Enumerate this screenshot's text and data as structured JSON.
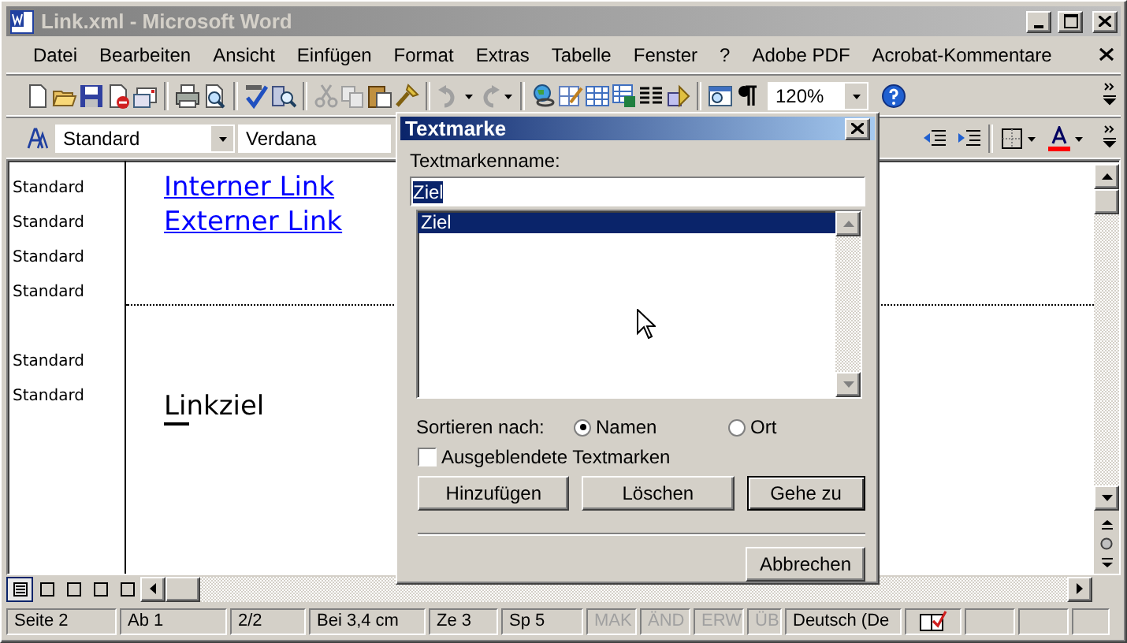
{
  "window": {
    "title": "Link.xml - Microsoft Word"
  },
  "menu": [
    "Datei",
    "Bearbeiten",
    "Ansicht",
    "Einfügen",
    "Format",
    "Extras",
    "Tabelle",
    "Fenster",
    "?",
    "Adobe PDF",
    "Acrobat-Kommentare"
  ],
  "standard_toolbar": {
    "zoom": "120%"
  },
  "formatting_toolbar": {
    "style": "Standard",
    "font": "Verdana"
  },
  "document": {
    "paragraphs": [
      {
        "kind": "link",
        "style": "Standard",
        "text": "Interner Link"
      },
      {
        "kind": "link",
        "style": "Standard",
        "text": "Externer Link"
      },
      {
        "kind": "empty",
        "style": "Standard"
      },
      {
        "kind": "empty",
        "style": "Standard"
      },
      {
        "kind": "break"
      },
      {
        "kind": "empty",
        "style": "Standard"
      },
      {
        "kind": "text",
        "style": "Standard",
        "text": "Linkziel"
      }
    ]
  },
  "view_buttons": [
    {
      "selected": true
    },
    {
      "selected": false
    },
    {
      "selected": false
    },
    {
      "selected": false
    },
    {
      "selected": false
    }
  ],
  "status_bar": [
    {
      "text": "Seite 2",
      "disabled": false
    },
    {
      "text": "Ab 1",
      "disabled": false
    },
    {
      "text": "2/2",
      "disabled": false
    },
    {
      "text": "Bei 3,4 cm",
      "disabled": false
    },
    {
      "text": "Ze 3",
      "disabled": false
    },
    {
      "text": "Sp 5",
      "disabled": false
    },
    {
      "text": "MAK",
      "disabled": true
    },
    {
      "text": "ÄND",
      "disabled": true
    },
    {
      "text": "ERW",
      "disabled": true
    },
    {
      "text": "ÜB",
      "disabled": true
    },
    {
      "text": "Deutsch (De",
      "disabled": false
    }
  ],
  "dialog": {
    "title": "Textmarke",
    "name_label": "Textmarkenname:",
    "name_value": "Ziel",
    "bookmarks": [
      {
        "label": "Ziel",
        "selected": true
      }
    ],
    "sort_label": "Sortieren nach:",
    "sort_options": [
      {
        "label": "Namen",
        "selected": true
      },
      {
        "label": "Ort",
        "selected": false
      }
    ],
    "hidden_checkbox": {
      "label": "Ausgeblendete Textmarken",
      "checked": false
    },
    "buttons": [
      {
        "label": "Hinzufügen",
        "default": false
      },
      {
        "label": "Löschen",
        "default": false
      },
      {
        "label": "Gehe zu",
        "default": true
      }
    ],
    "cancel": "Abbrechen"
  }
}
